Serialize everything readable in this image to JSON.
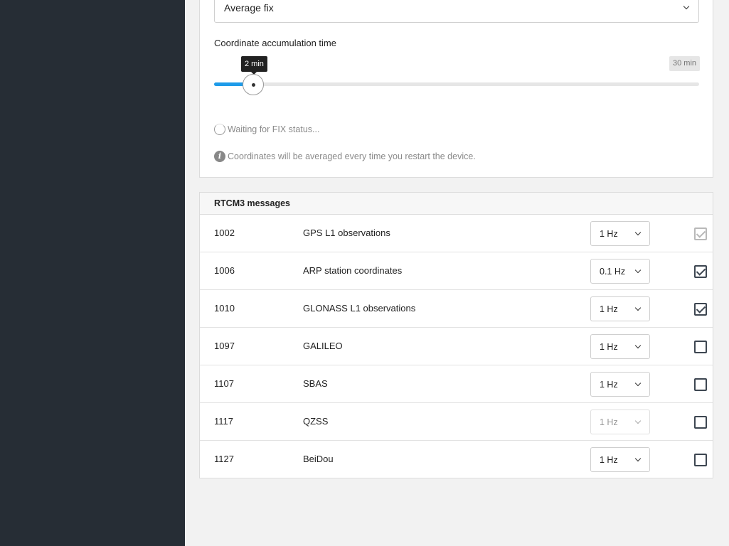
{
  "mode_select": {
    "value": "Average fix",
    "icon": "chevron-down-icon"
  },
  "accumulation": {
    "label": "Coordinate accumulation time",
    "current_label": "2 min",
    "max_label": "30 min",
    "current_min": 2,
    "max_min": 30,
    "accent_color": "#1e9be9"
  },
  "status": {
    "text": "Waiting for FIX status...",
    "icon": "spinner-icon"
  },
  "info": {
    "text": "Coordinates will be averaged every time you restart the device.",
    "icon": "info-icon"
  },
  "rtcm": {
    "title": "RTCM3 messages",
    "rows": [
      {
        "id": "1002",
        "name": "GPS L1 observations",
        "rate": "1 Hz",
        "rate_disabled": false,
        "checked": true,
        "check_disabled": true
      },
      {
        "id": "1006",
        "name": "ARP station coordinates",
        "rate": "0.1 Hz",
        "rate_disabled": false,
        "checked": true,
        "check_disabled": false
      },
      {
        "id": "1010",
        "name": "GLONASS L1 observations",
        "rate": "1 Hz",
        "rate_disabled": false,
        "checked": true,
        "check_disabled": false
      },
      {
        "id": "1097",
        "name": "GALILEO",
        "rate": "1 Hz",
        "rate_disabled": false,
        "checked": false,
        "check_disabled": false
      },
      {
        "id": "1107",
        "name": "SBAS",
        "rate": "1 Hz",
        "rate_disabled": false,
        "checked": false,
        "check_disabled": false
      },
      {
        "id": "1117",
        "name": "QZSS",
        "rate": "1 Hz",
        "rate_disabled": true,
        "checked": false,
        "check_disabled": false
      },
      {
        "id": "1127",
        "name": "BeiDou",
        "rate": "1 Hz",
        "rate_disabled": false,
        "checked": false,
        "check_disabled": false
      }
    ]
  }
}
